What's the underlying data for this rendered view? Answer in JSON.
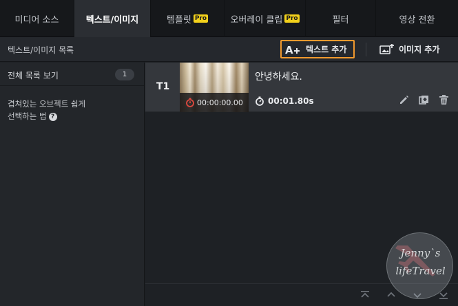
{
  "tabs": [
    {
      "label": "미디어 소스",
      "pro": false,
      "active": false
    },
    {
      "label": "텍스트/이미지",
      "pro": false,
      "active": true
    },
    {
      "label": "템플릿",
      "pro": true,
      "active": false
    },
    {
      "label": "오버레이 클립",
      "pro": true,
      "active": false
    },
    {
      "label": "필터",
      "pro": false,
      "active": false
    },
    {
      "label": "영상 전환",
      "pro": false,
      "active": false
    }
  ],
  "pro_badge": "Pro",
  "toolbar": {
    "list_title": "텍스트/이미지 목록",
    "add_text_label": "텍스트 추가",
    "add_image_label": "이미지 추가"
  },
  "sidebar": {
    "view_all_label": "전체 목록 보기",
    "view_all_count": "1",
    "help_line1": "겹쳐있는 오브젝트 쉽게",
    "help_line2": "선택하는 법"
  },
  "items": [
    {
      "track": "T1",
      "start_time": "00:00:00.00",
      "text": "안녕하세요.",
      "duration": "00:01.80s"
    }
  ],
  "watermark": {
    "line1": "Jenny`s",
    "line2": "lifeTravel"
  },
  "colors": {
    "highlight_border": "#f29a2e",
    "pro_badge": "#f3d11b",
    "timer_red": "#e0483e"
  }
}
